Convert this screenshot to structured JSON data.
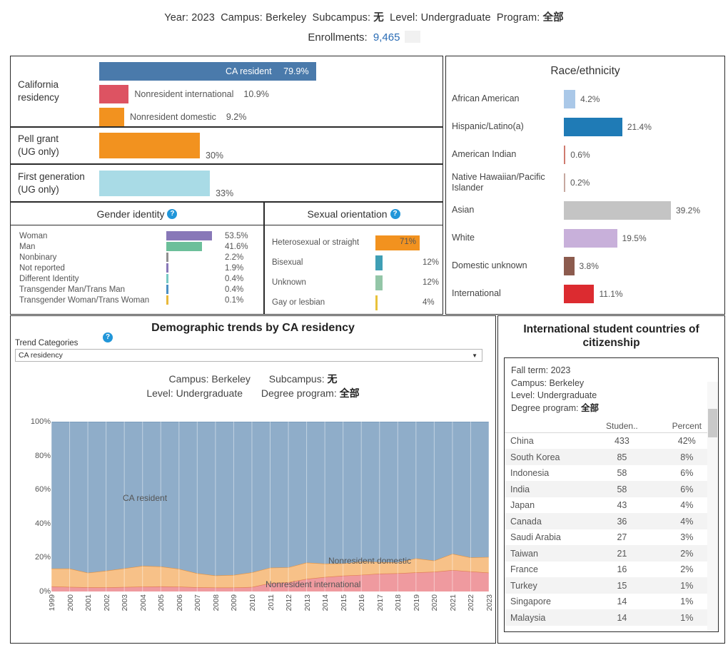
{
  "header": {
    "filters": "Year: 2023  Campus: Berkeley  Subcampus: 无  Level: Undergraduate  Program: 全部",
    "year_label": "Year:",
    "year_value": "2023",
    "campus_label": "Campus:",
    "campus_value": "Berkeley",
    "subcampus_label": "Subcampus:",
    "subcampus_value": "无",
    "level_label": "Level:",
    "level_value": "Undergraduate",
    "program_label": "Program:",
    "program_value": "全部",
    "enrollments_label": "Enrollments:",
    "enrollments_value": "9,465"
  },
  "ca_residency": {
    "title": "California residency",
    "title_line1": "California",
    "title_line2": "residency",
    "items": [
      {
        "label": "CA resident",
        "pct": "79.9%",
        "value": 79.9,
        "color": "#4a7aab",
        "inside": true
      },
      {
        "label": "Nonresident international",
        "pct": "10.9%",
        "value": 10.9,
        "color": "#dd5362",
        "inside": false
      },
      {
        "label": "Nonresident domestic",
        "pct": "9.2%",
        "value": 9.2,
        "color": "#f2921f",
        "inside": false
      }
    ]
  },
  "pell": {
    "label_line1": "Pell grant",
    "label_line2": "(UG only)",
    "pct": "30%",
    "value": 30,
    "color": "#f2921f"
  },
  "first_generation": {
    "label_line1": "First generation",
    "label_line2": "(UG only)",
    "pct": "33%",
    "value": 33,
    "color": "#a9dbe6"
  },
  "gender_identity": {
    "title": "Gender identity",
    "help_icon": "question-icon",
    "items": [
      {
        "label": "Woman",
        "pct": "53.5%",
        "value": 53.5,
        "color": "#8878b8",
        "inside": false
      },
      {
        "label": "Man",
        "pct": "41.6%",
        "value": 41.6,
        "color": "#6cbf9a",
        "inside": true
      },
      {
        "label": "Nonbinary",
        "pct": "2.2%",
        "value": 2.2,
        "color": "#8f8f8f",
        "inside": false
      },
      {
        "label": "Not reported",
        "pct": "1.9%",
        "value": 1.9,
        "color": "#8878b8",
        "inside": false
      },
      {
        "label": "Different Identity",
        "pct": "0.4%",
        "value": 0.4,
        "color": "#76c9c4",
        "inside": false
      },
      {
        "label": "Transgender Man/Trans Man",
        "pct": "0.4%",
        "value": 0.4,
        "color": "#4a90c4",
        "inside": false
      },
      {
        "label": "Transgender Woman/Trans Woman",
        "pct": "0.1%",
        "value": 0.1,
        "color": "#e8b93b",
        "inside": false
      }
    ]
  },
  "sexual_orientation": {
    "title": "Sexual orientation",
    "help_icon": "question-icon",
    "items": [
      {
        "label": "Heterosexual or straight",
        "pct": "71%",
        "value": 71,
        "color": "#f2921f",
        "inside": true
      },
      {
        "label": "Bisexual",
        "pct": "12%",
        "value": 12,
        "color": "#3f9fb5",
        "inside": false
      },
      {
        "label": "Unknown",
        "pct": "12%",
        "value": 12,
        "color": "#93c6a7",
        "inside": false
      },
      {
        "label": "Gay or lesbian",
        "pct": "4%",
        "value": 4,
        "color": "#e8c23b",
        "inside": false
      }
    ]
  },
  "race_ethnicity": {
    "title": "Race/ethnicity",
    "items": [
      {
        "label": "African American",
        "pct": "4.2%",
        "value": 4.2,
        "color": "#aac8e8"
      },
      {
        "label": "Hispanic/Latino(a)",
        "pct": "21.4%",
        "value": 21.4,
        "color": "#1f7bb6"
      },
      {
        "label": "American Indian",
        "pct": "0.6%",
        "value": 0.6,
        "color": "#cf7b6f"
      },
      {
        "label": "Native Hawaiian/Pacific Islander",
        "pct": "0.2%",
        "value": 0.2,
        "color": "#c7a9a0"
      },
      {
        "label": "Asian",
        "pct": "39.2%",
        "value": 39.2,
        "color": "#c4c4c4"
      },
      {
        "label": "White",
        "pct": "19.5%",
        "value": 19.5,
        "color": "#c8b0da"
      },
      {
        "label": "Domestic unknown",
        "pct": "3.8%",
        "value": 3.8,
        "color": "#8c5b4e"
      },
      {
        "label": "International",
        "pct": "11.1%",
        "value": 11.1,
        "color": "#dc2b30"
      }
    ]
  },
  "trends": {
    "title": "Demographic trends by CA residency",
    "control_label": "Trend Categories",
    "help_icon": "question-icon",
    "select_value": "CA residency",
    "select_options": [
      "CA residency"
    ],
    "caret_icon": "chevron-down-icon",
    "sub_campus_label": "Campus:",
    "sub_campus_value": "Berkeley",
    "sub_subcampus_label": "Subcampus:",
    "sub_subcampus_value": "无",
    "sub_level_label": "Level:",
    "sub_level_value": "Undergraduate",
    "sub_program_label": "Degree program:",
    "sub_program_value": "全部",
    "series_labels": {
      "ca": "CA resident",
      "domestic": "Nonresident domestic",
      "international": "Nonresident international"
    }
  },
  "international": {
    "title": "International student countries of citizenship",
    "term_label": "Fall term:",
    "term_value": "2023",
    "campus_label": "Campus:",
    "campus_value": "Berkeley",
    "level_label": "Level:",
    "level_value": "Undergraduate",
    "program_label": "Degree program:",
    "program_value": "全部",
    "meta_lines": [
      "Fall term: 2023",
      "Campus: Berkeley",
      "Level: Undergraduate",
      "Degree program: 全部"
    ],
    "columns": [
      "",
      "Studen..",
      "Percent"
    ],
    "rows": [
      {
        "country": "China",
        "students": "433",
        "percent": "42%"
      },
      {
        "country": "South Korea",
        "students": "85",
        "percent": "8%"
      },
      {
        "country": "Indonesia",
        "students": "58",
        "percent": "6%"
      },
      {
        "country": "India",
        "students": "58",
        "percent": "6%"
      },
      {
        "country": "Japan",
        "students": "43",
        "percent": "4%"
      },
      {
        "country": "Canada",
        "students": "36",
        "percent": "4%"
      },
      {
        "country": "Saudi Arabia",
        "students": "27",
        "percent": "3%"
      },
      {
        "country": "Taiwan",
        "students": "21",
        "percent": "2%"
      },
      {
        "country": "France",
        "students": "16",
        "percent": "2%"
      },
      {
        "country": "Turkey",
        "students": "15",
        "percent": "1%"
      },
      {
        "country": "Singapore",
        "students": "14",
        "percent": "1%"
      },
      {
        "country": "Malaysia",
        "students": "14",
        "percent": "1%"
      }
    ]
  },
  "chart_data": {
    "type": "area",
    "title": "Demographic trends by CA residency",
    "stacked": true,
    "normalized": true,
    "xlabel": "",
    "ylabel": "",
    "ylim": [
      0,
      100
    ],
    "yticks": [
      "0%",
      "20%",
      "40%",
      "60%",
      "80%",
      "100%"
    ],
    "grid": true,
    "x": [
      "1999",
      "2000",
      "2001",
      "2002",
      "2003",
      "2004",
      "2005",
      "2006",
      "2007",
      "2008",
      "2009",
      "2010",
      "2011",
      "2012",
      "2013",
      "2014",
      "2015",
      "2016",
      "2017",
      "2018",
      "2019",
      "2020",
      "2021",
      "2022",
      "2023"
    ],
    "series": [
      {
        "name": "Nonresident international",
        "color": "#ef9a9f",
        "values": [
          3.0,
          2.7,
          2.5,
          2.4,
          2.6,
          2.8,
          3.0,
          2.8,
          2.5,
          2.3,
          2.3,
          2.6,
          4.9,
          5.4,
          7.4,
          8.5,
          9.3,
          9.8,
          10.5,
          10.7,
          11.2,
          11.6,
          12.6,
          11.8,
          11.1
        ]
      },
      {
        "name": "Nonresident domestic",
        "color": "#f7c188",
        "values": [
          10.5,
          10.8,
          8.5,
          9.8,
          11.0,
          12.3,
          11.7,
          10.5,
          8.2,
          7.1,
          7.4,
          8.6,
          9.1,
          8.8,
          9.6,
          7.9,
          7.2,
          7.8,
          6.8,
          6.4,
          8.3,
          6.6,
          9.6,
          8.2,
          9.2
        ]
      },
      {
        "name": "CA resident",
        "color": "#8fadc9",
        "values": [
          86.5,
          86.5,
          89.0,
          87.8,
          86.4,
          84.9,
          85.3,
          86.7,
          89.3,
          90.6,
          90.3,
          88.8,
          86.0,
          85.8,
          83.0,
          83.6,
          83.5,
          82.4,
          82.7,
          82.9,
          80.5,
          81.8,
          77.8,
          80.0,
          79.7
        ]
      }
    ]
  }
}
